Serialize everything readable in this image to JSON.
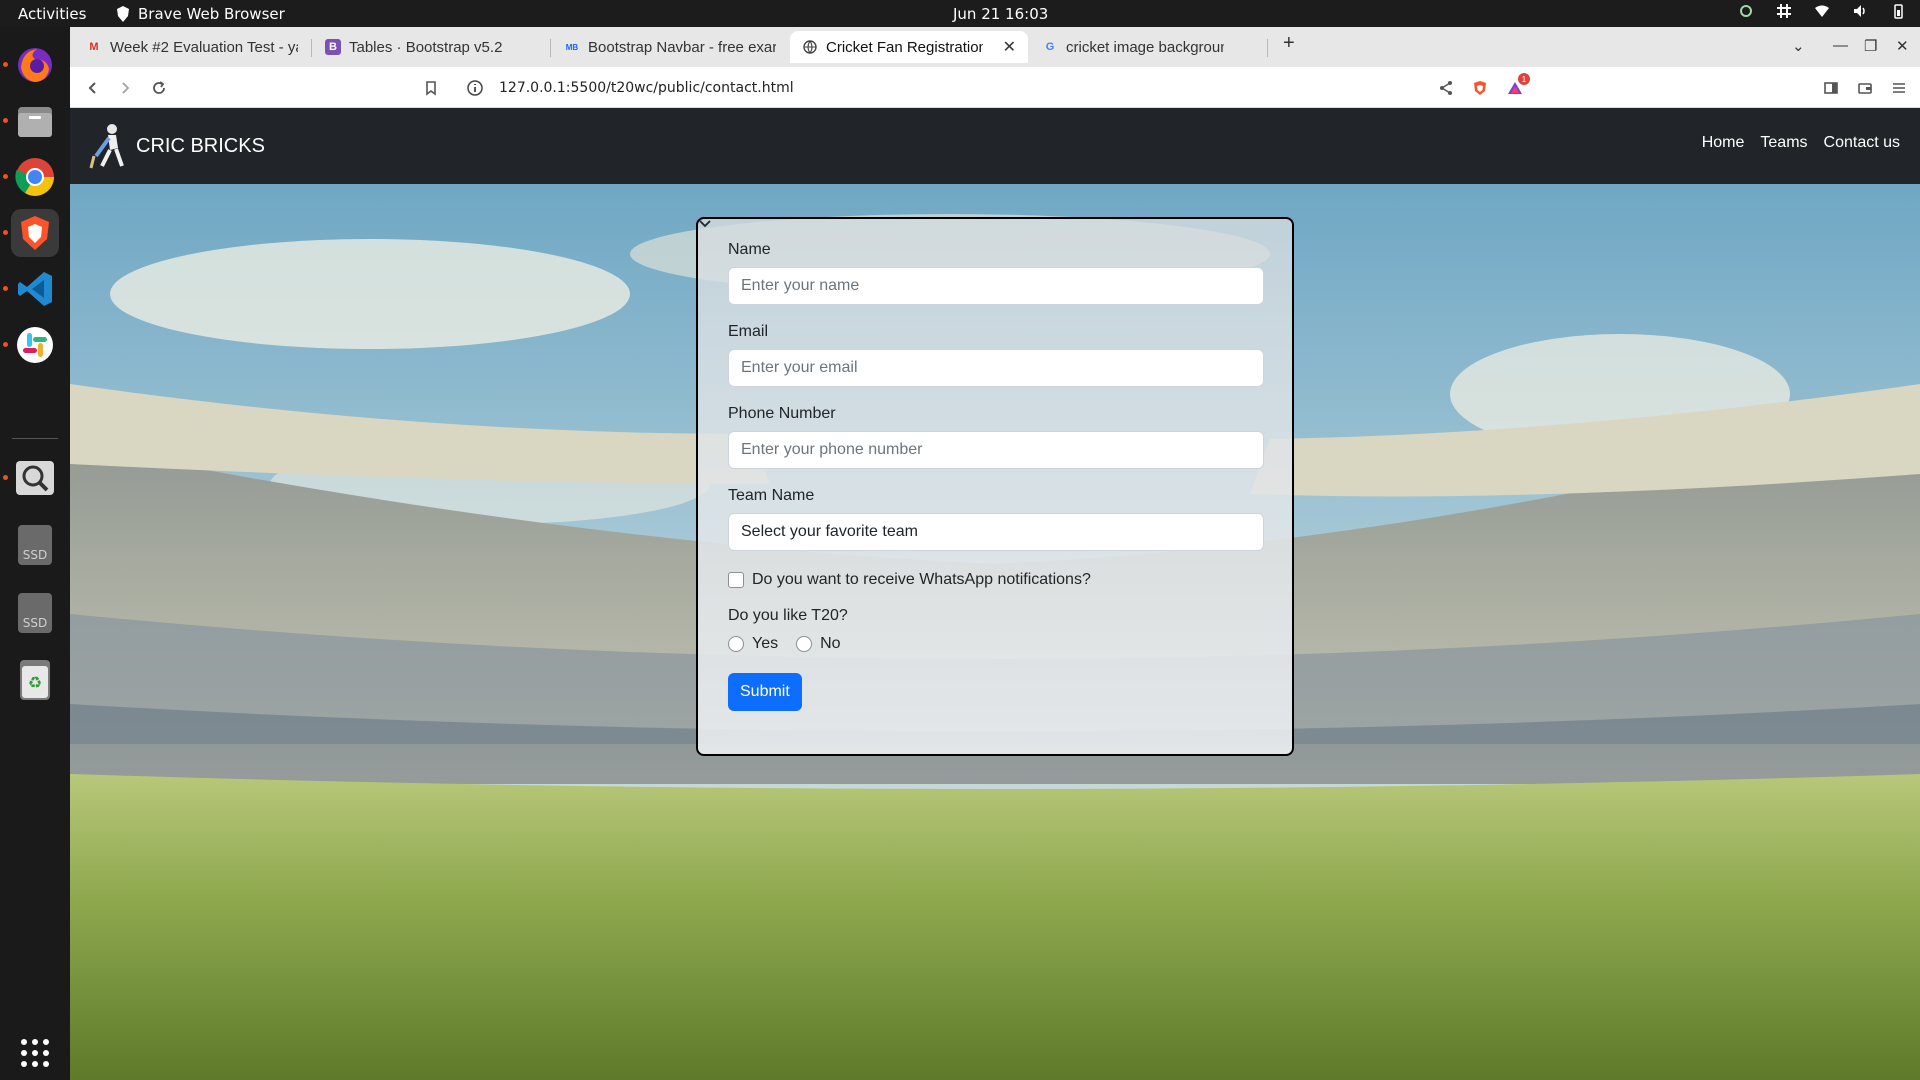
{
  "system": {
    "activities": "Activities",
    "app_name": "Brave Web Browser",
    "clock": "Jun 21  16:03"
  },
  "dock": {
    "items": [
      "firefox-icon",
      "files-icon",
      "chrome-icon",
      "brave-icon",
      "vscode-icon",
      "slack-icon",
      "search-tool-icon",
      "ssd-drive-icon",
      "ssd-drive-icon",
      "trash-icon",
      "app-grid-icon"
    ],
    "ssd_label": "SSD"
  },
  "browser": {
    "tabs": [
      {
        "label": "Week #2 Evaluation Test - ya",
        "fav": "M",
        "fav_color": "#d93025"
      },
      {
        "label": "Tables · Bootstrap v5.2",
        "fav": "B",
        "fav_color": "#7952b3"
      },
      {
        "label": "Bootstrap Navbar - free exar",
        "fav": "MB",
        "fav_color": "#1266f1"
      },
      {
        "label": "Cricket Fan Registration",
        "fav": "globe",
        "fav_color": "#444444"
      },
      {
        "label": "cricket image background - C",
        "fav": "G",
        "fav_color": "#4285f4"
      }
    ],
    "url": "127.0.0.1:5500/t20wc/public/contact.html",
    "notification_count": "1"
  },
  "page": {
    "brand": "CRIC BRICKS",
    "nav": [
      "Home",
      "Teams",
      "Contact us"
    ],
    "form": {
      "name_label": "Name",
      "name_placeholder": "Enter your name",
      "email_label": "Email",
      "email_placeholder": "Enter your email",
      "phone_label": "Phone Number",
      "phone_placeholder": "Enter your phone number",
      "team_label": "Team Name",
      "team_selected": "Select your favorite team",
      "whatsapp_label": "Do you want to receive WhatsApp notifications?",
      "t20_question": "Do you like T20?",
      "t20_yes": "Yes",
      "t20_no": "No",
      "submit": "Submit"
    },
    "colors": {
      "navbar": "#212529",
      "primary": "#0d6efd"
    }
  }
}
